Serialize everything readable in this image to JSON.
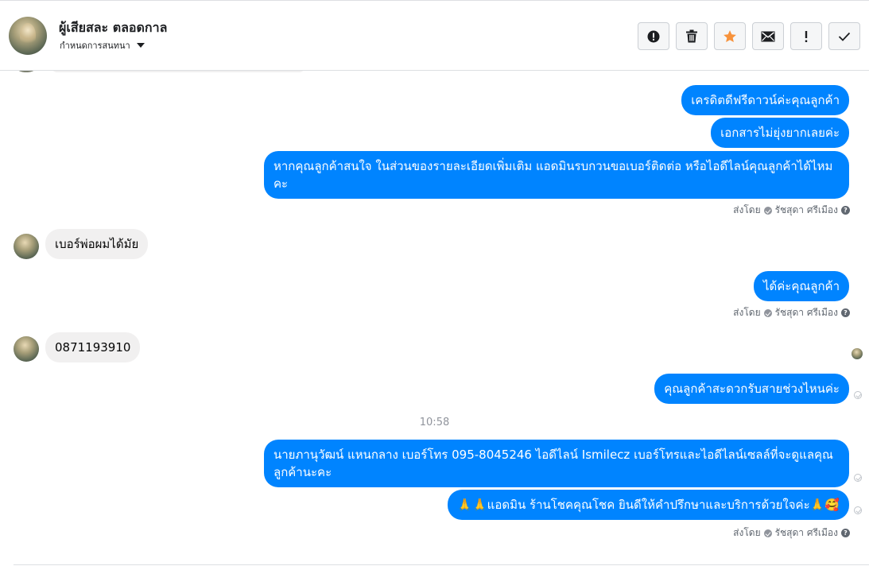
{
  "header": {
    "name": "ผู้เสียสละ ตลอดกาล",
    "subtitle": "กำหนดการสนทนา",
    "toolbar": [
      {
        "name": "spam-button",
        "icon": "alert-circle-icon"
      },
      {
        "name": "delete-button",
        "icon": "trash-icon"
      },
      {
        "name": "star-button",
        "icon": "star-icon",
        "color": "#f7923b"
      },
      {
        "name": "mark-unread-button",
        "icon": "envelope-icon"
      },
      {
        "name": "follow-up-button",
        "icon": "exclamation-icon"
      },
      {
        "name": "mark-done-button",
        "icon": "check-icon"
      }
    ]
  },
  "messages": [
    {
      "dir": "out",
      "text": "เครดิตดีฟรีดาวน์ค่ะคุณลูกค้า"
    },
    {
      "dir": "out",
      "text": "เอกสารไม่ยุ่งยากเลยค่ะ"
    },
    {
      "dir": "out",
      "text": "หากคุณลูกค้าสนใจ ในส่วนของรายละเอียดเพิ่มเติม แอดมินรบกวนขอเบอร์ติดต่อ หรือไอดีไลน์คุณลูกค้าได้ไหมคะ"
    },
    {
      "dir": "in",
      "text": "เบอร์พ่อผมได้มัย"
    },
    {
      "dir": "out",
      "text": "ได้ค่ะคุณลูกค้า"
    },
    {
      "dir": "in",
      "text": "0871193910"
    },
    {
      "dir": "out",
      "text": "คุณลูกค้าสะดวกรับสายช่วงไหนค่ะ"
    },
    {
      "dir": "out",
      "text": "นายภานุวัฒน์ แหนกลาง เบอร์โทร 095-8045246 ไอดีไลน์ Ismilecz   เบอร์โทรและไอดีไลน์เซลล์ที่จะดูแลคุณลูกค้านะคะ"
    },
    {
      "dir": "out",
      "text": "🙏🙏แอดมิน ร้านโชคคุณโชค ยินดีให้คำปรึกษาและบริการด้วยใจค่ะ🙏🥰"
    }
  ],
  "sent_by": {
    "prefix": "ส่งโดย",
    "agent": "รัชสุดา ศรีเมือง"
  },
  "timestamp": "10:58"
}
